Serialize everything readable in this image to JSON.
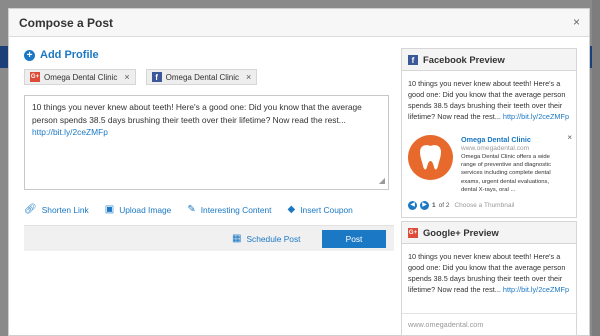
{
  "modal": {
    "title": "Compose a Post",
    "close": "×"
  },
  "add_profile": {
    "label": "Add Profile",
    "icon": "+"
  },
  "profiles": [
    {
      "name": "Omega Dental Clinic",
      "network_badge": "G+",
      "remove": "×"
    },
    {
      "name": "Omega Dental Clinic",
      "network_badge": "f",
      "remove": "×"
    }
  ],
  "compose": {
    "text": "10 things you never knew about teeth!  Here's a good one: Did you know that the average person spends 38.5 days brushing their teeth over their lifetime?  Now read the rest... ",
    "link": "http://bit.ly/2ceZMFp"
  },
  "actions": {
    "shorten": "Shorten Link",
    "upload": "Upload Image",
    "interesting": "Interesting Content",
    "coupon": "Insert Coupon"
  },
  "footer": {
    "schedule": "Schedule Post",
    "post": "Post"
  },
  "facebook_preview": {
    "title": "Facebook Preview",
    "badge": "f",
    "text": "10 things you never knew about teeth!  Here's a good one: Did you know that the average person spends 38.5 days brushing their teeth over their lifetime?  Now read the rest... ",
    "link": "http://bit.ly/2ceZMFp",
    "card": {
      "title": "Omega Dental Clinic",
      "url": "www.omegadental.com",
      "description": "Omega Dental Clinic offers a wide range of preventive and diagnostic services including complete dental exams, urgent dental evaluations, dental X-rays, oral ...",
      "close": "×"
    },
    "thumb": {
      "page": "1",
      "of": "of 2",
      "choose": "Choose a Thumbnail"
    }
  },
  "googleplus_preview": {
    "title": "Google+ Preview",
    "badge": "G+",
    "text": "10 things you never knew about teeth!  Here's a good one: Did you know that the average person spends 38.5 days brushing their teeth over their lifetime?  Now read the rest... ",
    "link": "http://bit.ly/2ceZMFp",
    "domain": "www.omegadental.com"
  },
  "colors": {
    "accent": "#1b78c4",
    "facebook": "#3b5998",
    "googleplus": "#dd4b39",
    "tooth_bg": "#e8692c"
  }
}
